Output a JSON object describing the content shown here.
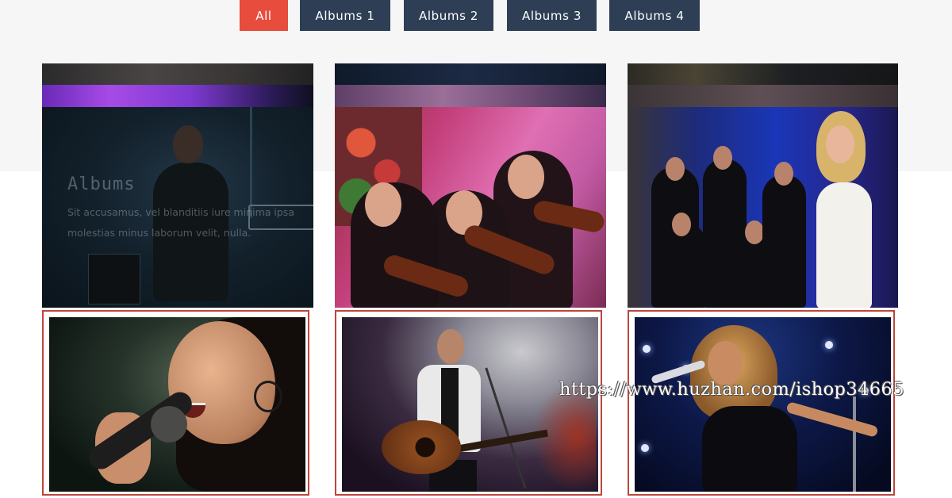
{
  "filters": {
    "items": [
      {
        "label": "All",
        "active": true
      },
      {
        "label": "Albums 1",
        "active": false
      },
      {
        "label": "Albums 2",
        "active": false
      },
      {
        "label": "Albums 3",
        "active": false
      },
      {
        "label": "Albums 4",
        "active": false
      }
    ]
  },
  "gallery": {
    "overlay": {
      "title": "Albums",
      "text": "Sit accusamus, vel blanditiis iure minima ipsa molestias minus laborum velit, nulla."
    },
    "tiles": [
      {
        "name": "rock-guitarist-photo"
      },
      {
        "name": "violinists-photo"
      },
      {
        "name": "singer-with-orchestra-photo"
      },
      {
        "name": "female-singer-closeup-photo"
      },
      {
        "name": "guitarist-singer-photo"
      },
      {
        "name": "diva-singer-photo"
      }
    ]
  },
  "watermark": "https://www.huzhan.com/ishop34665",
  "colors": {
    "active_filter": "#e74c3c",
    "filter": "#2e3f55",
    "frame_border": "#c0453a"
  }
}
